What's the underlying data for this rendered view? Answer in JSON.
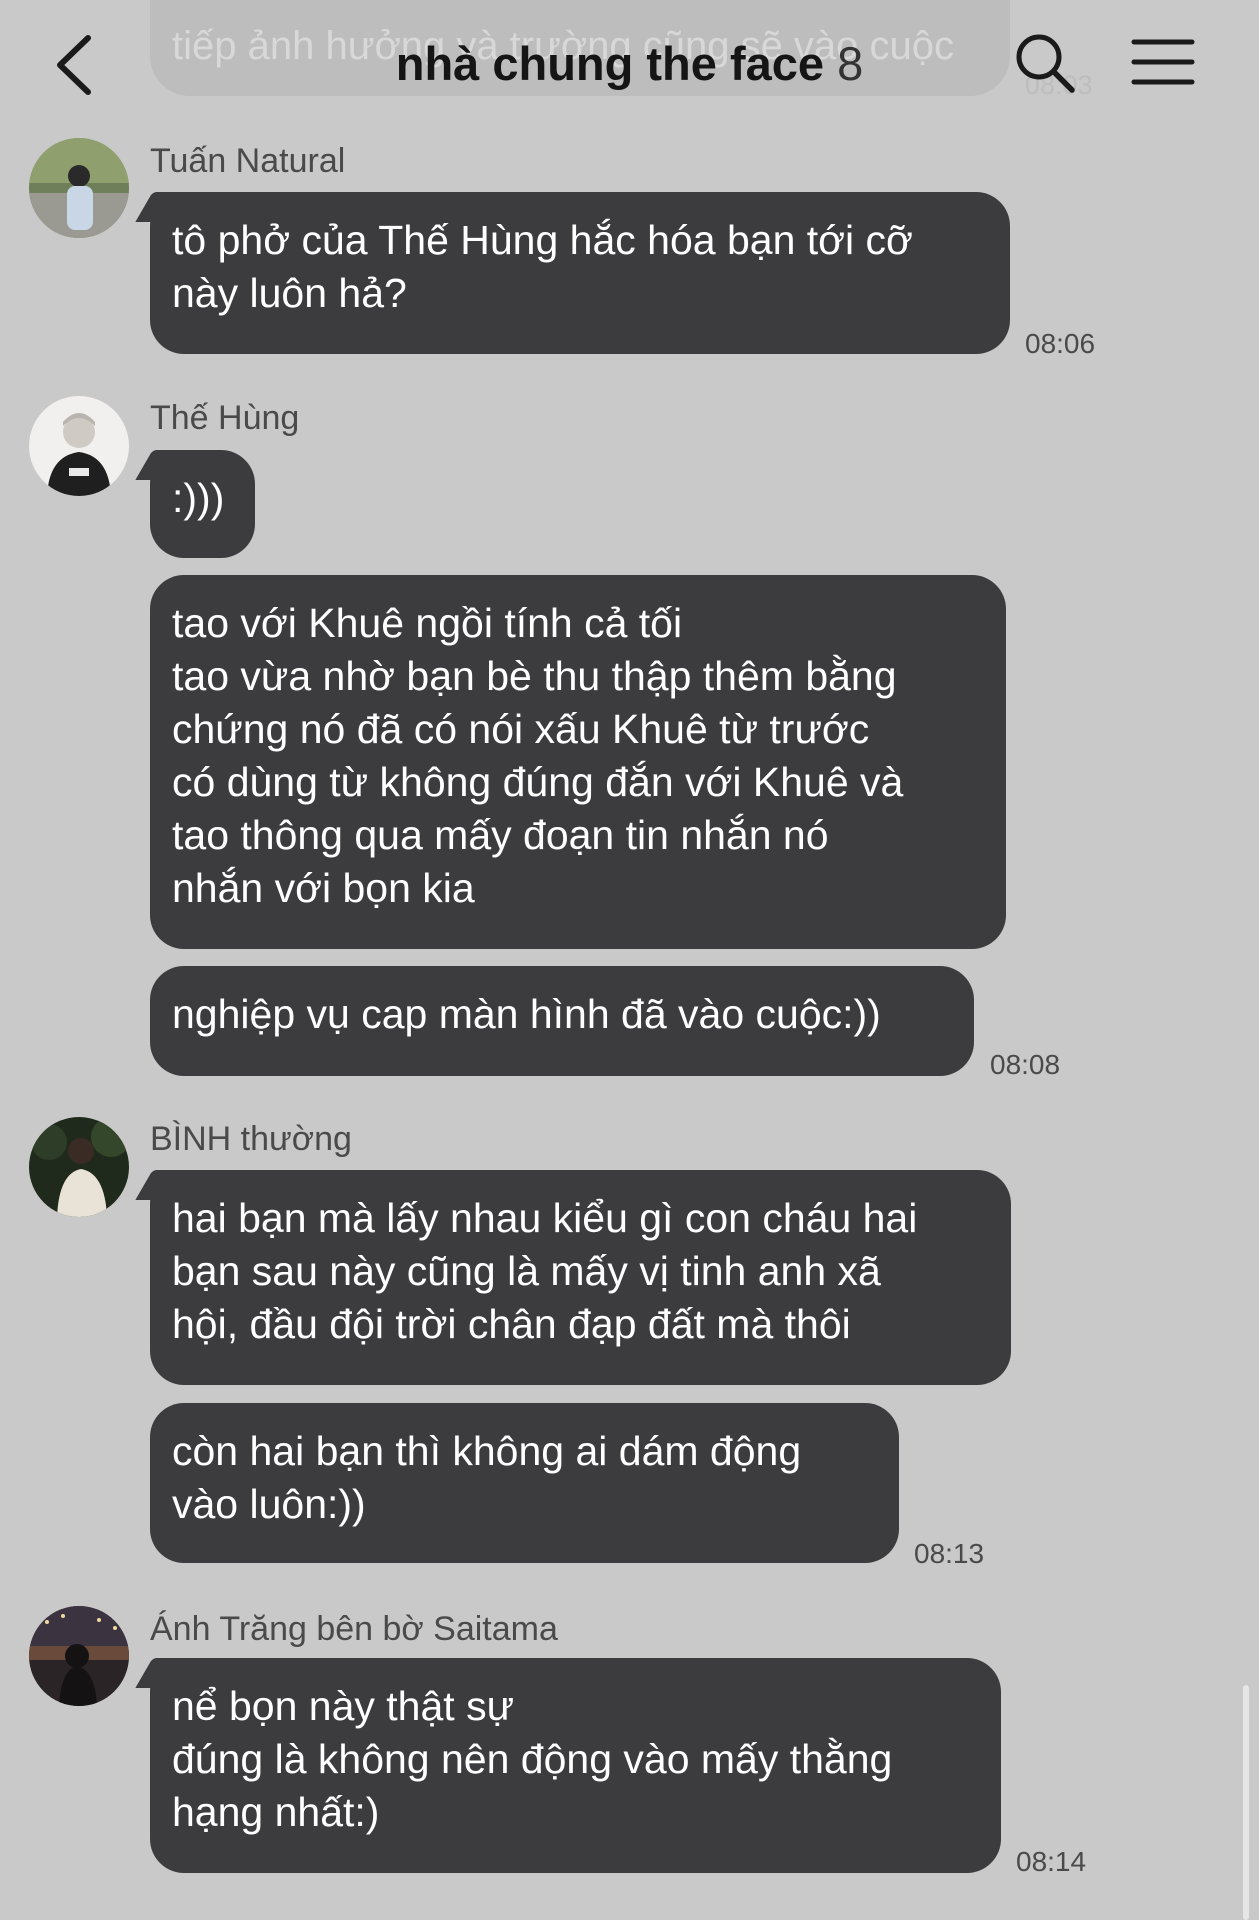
{
  "header": {
    "title": "nhà chung the face",
    "member_count": "8",
    "back_icon": "chevron-left-icon",
    "search_icon": "search-icon",
    "menu_icon": "menu-icon"
  },
  "partial_message": {
    "text": "tiếp ảnh hưởng và trường cũng sẽ vào cuộc",
    "time": "08:03"
  },
  "messages": [
    {
      "sender": "Tuấn Natural",
      "avatar": "avatar-tuan",
      "bubbles": [
        "tô phở của Thế Hùng hắc hóa bạn tới cỡ\nnày luôn hả?"
      ],
      "time": "08:06"
    },
    {
      "sender": "Thế Hùng",
      "avatar": "avatar-the-hung",
      "bubbles": [
        ":)))",
        "tao với Khuê ngồi tính cả tối\ntao vừa nhờ bạn bè thu thập thêm bằng\nchứng nó đã có nói xấu Khuê từ trước\ncó dùng từ không đúng đắn với Khuê và\ntao thông qua mấy đoạn tin nhắn nó\nnhắn với bọn kia",
        "nghiệp vụ cap màn hình đã vào cuộc:))"
      ],
      "time": "08:08"
    },
    {
      "sender": "BÌNH thường",
      "avatar": "avatar-binh",
      "bubbles": [
        "hai bạn mà lấy nhau kiểu gì con cháu hai\nbạn sau này cũng là mấy vị tinh anh xã\nhội, đầu đội trời chân đạp đất mà thôi",
        "còn hai bạn thì không ai dám động\nvào luôn:))"
      ],
      "time": "08:13"
    },
    {
      "sender": "Ánh Trăng bên bờ Saitama",
      "avatar": "avatar-anh-trang",
      "bubbles": [
        "nể bọn này thật sự\nđúng là không nên động vào mấy thằng\nhạng nhất:)"
      ],
      "time": "08:14"
    }
  ],
  "colors": {
    "background": "#c9c9c9",
    "bubble": "#3c3c3e",
    "bubble_text": "#ffffff",
    "meta_text": "#4a4a4a"
  }
}
